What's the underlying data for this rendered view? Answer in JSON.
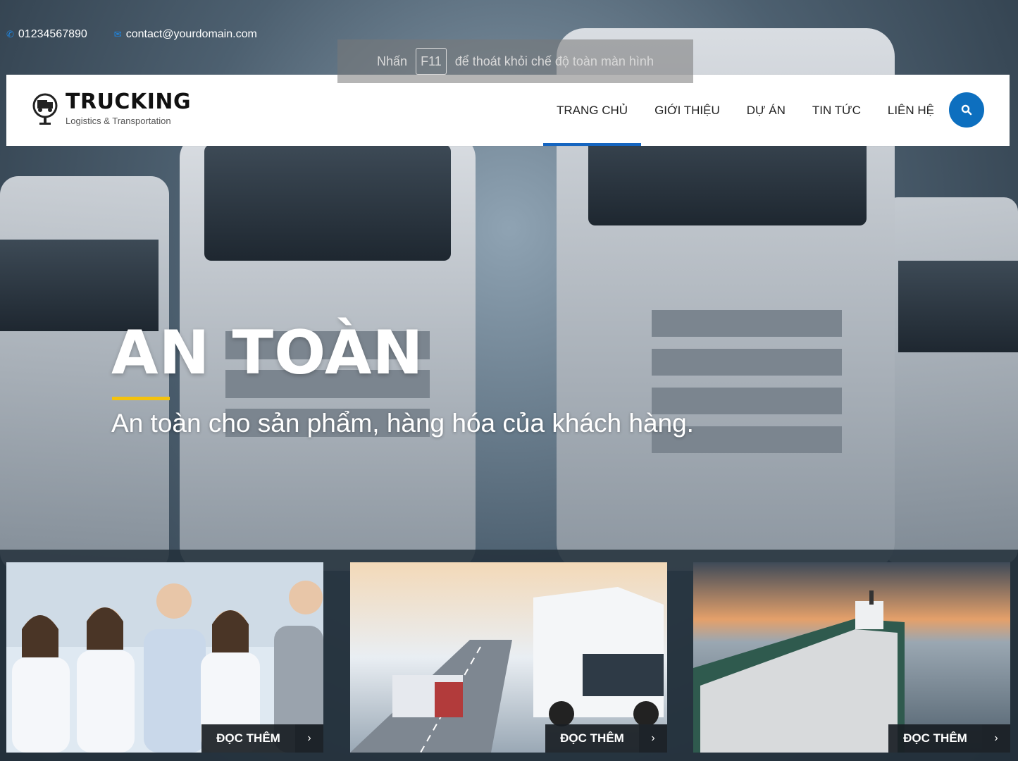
{
  "topbar": {
    "phone": "01234567890",
    "email": "contact@yourdomain.com"
  },
  "overlay": {
    "prefix": "Nhấn",
    "key": "F11",
    "suffix": "để thoát khỏi chế độ toàn màn hình"
  },
  "logo": {
    "brand": "TRUCKING",
    "tagline": "Logistics & Transportation"
  },
  "nav": {
    "items": [
      {
        "label": "TRANG CHỦ",
        "active": true
      },
      {
        "label": "GIỚI THIỆU",
        "active": false
      },
      {
        "label": "DỰ ÁN",
        "active": false
      },
      {
        "label": "TIN TỨC",
        "active": false
      },
      {
        "label": "LIÊN HỆ",
        "active": false
      }
    ]
  },
  "hero": {
    "title": "AN TOÀN",
    "subtitle": "An toàn cho sản phẩm, hàng hóa của khách hàng."
  },
  "cards": [
    {
      "image": "team-photo",
      "button": "ĐỌC THÊM"
    },
    {
      "image": "truck-highway-photo",
      "button": "ĐỌC THÊM"
    },
    {
      "image": "cargo-ship-photo",
      "button": "ĐỌC THÊM"
    }
  ],
  "colors": {
    "accent": "#0d6fbf",
    "underline": "#f4c20d",
    "nav_active": "#1565c0"
  }
}
